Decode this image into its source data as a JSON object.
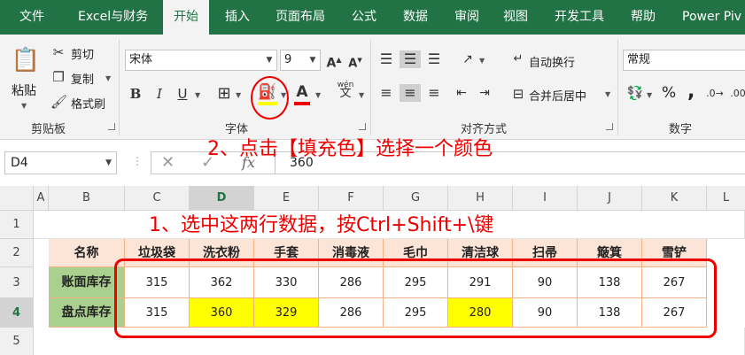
{
  "tabs": [
    "文件",
    "Excel与财务",
    "开始",
    "插入",
    "页面布局",
    "公式",
    "数据",
    "审阅",
    "视图",
    "开发工具",
    "帮助",
    "Power Piv"
  ],
  "clipboard": {
    "paste": "粘贴",
    "cut": "剪切",
    "copy": "复制",
    "format_painter": "格式刷",
    "label": "剪贴板"
  },
  "font": {
    "name": "宋体",
    "size": "9",
    "label": "字体",
    "wen": "wén",
    "wen_char": "文"
  },
  "align": {
    "wrap": "自动换行",
    "merge": "合并后居中",
    "label": "对齐方式"
  },
  "number": {
    "format": "常规",
    "percent": "%",
    "comma": ",",
    "label": "数字"
  },
  "name_box": "D4",
  "formula_value": "360",
  "fx": "fx",
  "annotations": {
    "step2": "2、点击【填充色】选择一个颜色",
    "step1": "1、选中这两行数据，按Ctrl+Shift+\\键"
  },
  "columns": [
    "A",
    "B",
    "C",
    "D",
    "E",
    "F",
    "G",
    "H",
    "I",
    "J",
    "K",
    "L"
  ],
  "rows": [
    "1",
    "2",
    "3",
    "4",
    "5"
  ],
  "table": {
    "header_label": "名称",
    "headers": [
      "垃圾袋",
      "洗衣粉",
      "手套",
      "消毒液",
      "毛巾",
      "清洁球",
      "扫帚",
      "簸箕",
      "雪铲"
    ],
    "row1_label": "账面库存",
    "row1": [
      "315",
      "362",
      "330",
      "286",
      "295",
      "291",
      "90",
      "138",
      "267"
    ],
    "row2_label": "盘点库存",
    "row2": [
      "315",
      "360",
      "329",
      "286",
      "295",
      "280",
      "90",
      "138",
      "267"
    ],
    "highlight_color": "#ffff00"
  },
  "colors": {
    "ribbon_tab": "#217346",
    "header_fill": "#fce4d6",
    "label_fill": "#a9d08e",
    "annotation": "#ee0000"
  }
}
